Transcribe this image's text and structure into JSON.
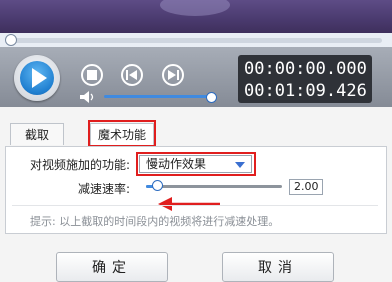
{
  "player": {
    "time_current": "00:00:00.000",
    "time_total": "00:01:09.426"
  },
  "tabs": [
    {
      "label": "截取"
    },
    {
      "label": "魔术功能"
    }
  ],
  "magic": {
    "effect_label": "对视频施加的功能:",
    "effect_value": "慢动作效果",
    "speed_label": "减速速率:",
    "speed_value": "2.00",
    "hint": "提示: 以上截取的时间段内的视频将进行减速处理。"
  },
  "buttons": {
    "ok": "确定",
    "cancel": "取消"
  },
  "colors": {
    "accent": "#1f7fd0",
    "highlight": "#e01e1e"
  }
}
